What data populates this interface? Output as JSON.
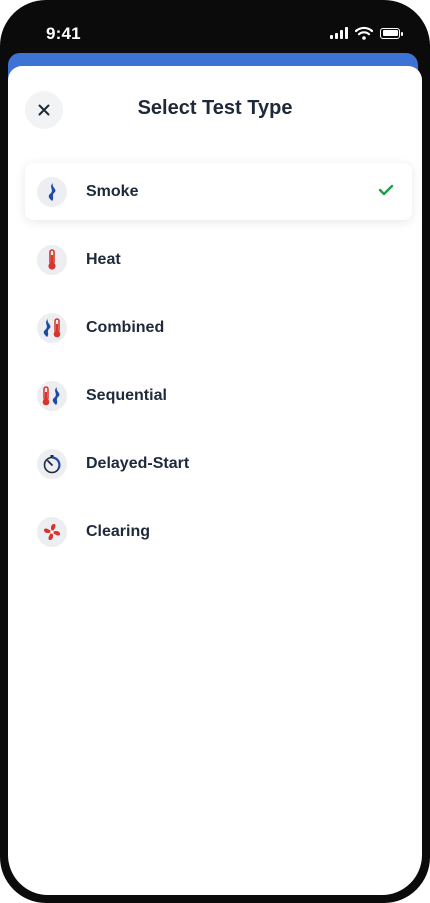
{
  "status_bar": {
    "time": "9:41"
  },
  "header": {
    "title": "Select Test Type",
    "close_icon": "close-icon"
  },
  "selected": "Smoke",
  "colors": {
    "accent_blue": "#3e73d6",
    "check_green": "#1f9d4a",
    "smoke_blue": "#1f4aa8",
    "heat_red": "#d6342c"
  },
  "test_types": [
    {
      "label": "Smoke",
      "icon": "smoke-icon",
      "selected": true
    },
    {
      "label": "Heat",
      "icon": "thermometer-icon",
      "selected": false
    },
    {
      "label": "Combined",
      "icon": "smoke-heat-icon",
      "selected": false
    },
    {
      "label": "Sequential",
      "icon": "heat-smoke-icon",
      "selected": false
    },
    {
      "label": "Delayed-Start",
      "icon": "timer-icon",
      "selected": false
    },
    {
      "label": "Clearing",
      "icon": "fan-icon",
      "selected": false
    }
  ]
}
